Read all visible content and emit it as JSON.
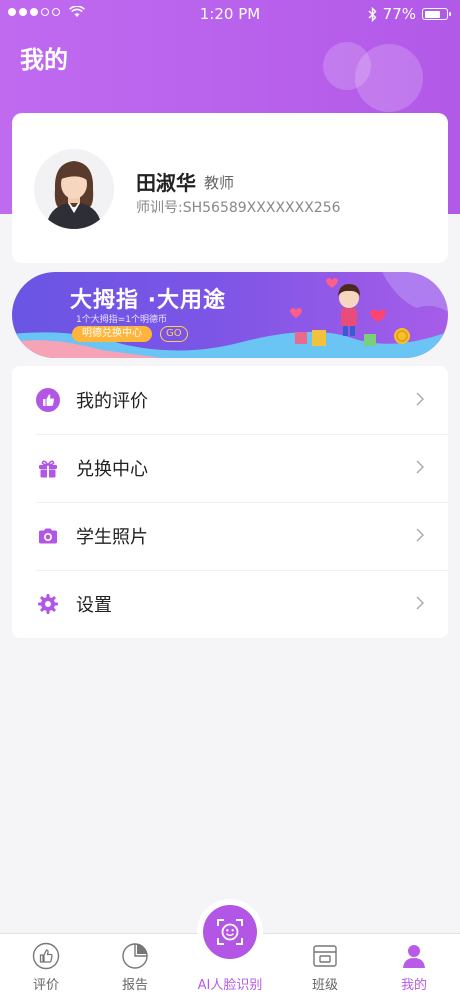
{
  "status_bar": {
    "time": "1:20 PM",
    "battery": "77%",
    "battery_level": 0.77,
    "icons": [
      "signal-dots-icon",
      "wifi-icon",
      "bluetooth-icon",
      "battery-icon"
    ]
  },
  "header": {
    "title": "我的"
  },
  "profile": {
    "name": "田淑华",
    "role": "教师",
    "teacher_id": "师训号:SH56589XXXXXXX256"
  },
  "banner": {
    "title": "大拇指 ·大用途",
    "subtitle": "1个大拇指=1个明德币",
    "button_label": "明德兑换中心",
    "go_label": "GO"
  },
  "menu": {
    "items": [
      {
        "label": "我的评价",
        "icon": "thumbs-up-icon"
      },
      {
        "label": "兑换中心",
        "icon": "gift-icon"
      },
      {
        "label": "学生照片",
        "icon": "camera-icon"
      },
      {
        "label": "设置",
        "icon": "gear-icon"
      }
    ]
  },
  "tabbar": {
    "items": [
      {
        "label": "评价",
        "icon": "thumbs-up-icon"
      },
      {
        "label": "报告",
        "icon": "pie-chart-icon"
      },
      {
        "label": "AI人脸识别",
        "icon": "face-scan-icon"
      },
      {
        "label": "班级",
        "icon": "class-icon"
      },
      {
        "label": "我的",
        "icon": "user-icon"
      }
    ],
    "active_index": 4
  },
  "colors": {
    "accent": "#b95be8",
    "header_gradient_start": "#c06af0",
    "header_gradient_end": "#b25ae8",
    "banner_gradient_start": "#6a55e4",
    "banner_gradient_end": "#a65de8",
    "banner_button": "#ffb43b"
  }
}
